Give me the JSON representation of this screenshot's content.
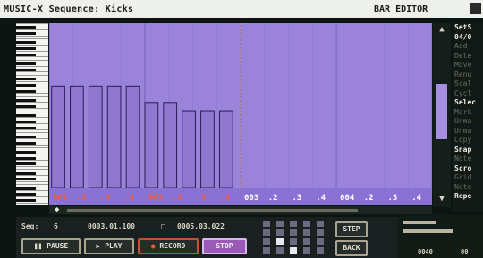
{
  "window": {
    "title": "MUSIC-X  Sequence: Kicks",
    "mode": "BAR EDITOR"
  },
  "editor": {
    "colors": {
      "grid_bg": "#9a83d9",
      "bar_fill": "#9077d0",
      "bar_outline": "#2b1d52",
      "tick_label_red": "#f05a3a",
      "tick_label_white": "#ffffff",
      "playhead": "#d8a04a"
    },
    "lane_labels": [
      "001",
      ".2",
      ".3",
      ".4",
      "002",
      ".2",
      ".3",
      ".4",
      "003",
      ".2",
      ".3",
      ".4",
      "004",
      ".2",
      ".3",
      ".4"
    ],
    "note_bars": [
      {
        "height_pct": 62
      },
      {
        "height_pct": 62
      },
      {
        "height_pct": 62
      },
      {
        "height_pct": 62
      },
      {
        "height_pct": 62
      },
      {
        "height_pct": 52
      },
      {
        "height_pct": 52
      },
      {
        "height_pct": 47
      },
      {
        "height_pct": 47
      },
      {
        "height_pct": 47
      }
    ]
  },
  "sidebar": {
    "items": [
      {
        "label": "SetS",
        "style": "hdr"
      },
      {
        "label": "04/0",
        "style": "hdr"
      },
      {
        "label": "Add",
        "style": "dim"
      },
      {
        "label": "Dele",
        "style": "dim"
      },
      {
        "label": "Move",
        "style": "dim"
      },
      {
        "label": "Renu",
        "style": "dim"
      },
      {
        "label": "Scal",
        "style": "dim"
      },
      {
        "label": "Cycl",
        "style": "dim"
      },
      {
        "label": "Selec",
        "style": "hdr"
      },
      {
        "label": "Mark",
        "style": "dim"
      },
      {
        "label": "Unma",
        "style": "dim"
      },
      {
        "label": "Unma",
        "style": "dim"
      },
      {
        "label": "Copy",
        "style": "dim"
      },
      {
        "label": "Snap",
        "style": "hdr"
      },
      {
        "label": "Note",
        "style": "dim"
      },
      {
        "label": "Scro",
        "style": "hdr"
      },
      {
        "label": "Grid",
        "style": "dim"
      },
      {
        "label": "Note",
        "style": "dim"
      },
      {
        "label": "Repe",
        "style": "hdr"
      }
    ]
  },
  "transport": {
    "seq_label": "Seq:",
    "seq_number": "6",
    "start_time": "0003.01.100",
    "end_time": "0005.03.022",
    "pause_label": "PAUSE",
    "play_label": "PLAY",
    "record_label": "RECORD",
    "stop_label": "STOP",
    "step_label": "STEP",
    "back_label": "BACK"
  },
  "mixer": {
    "values": [
      "0040",
      "00"
    ],
    "level_1_pct": 45,
    "level_2_pct": 70
  }
}
